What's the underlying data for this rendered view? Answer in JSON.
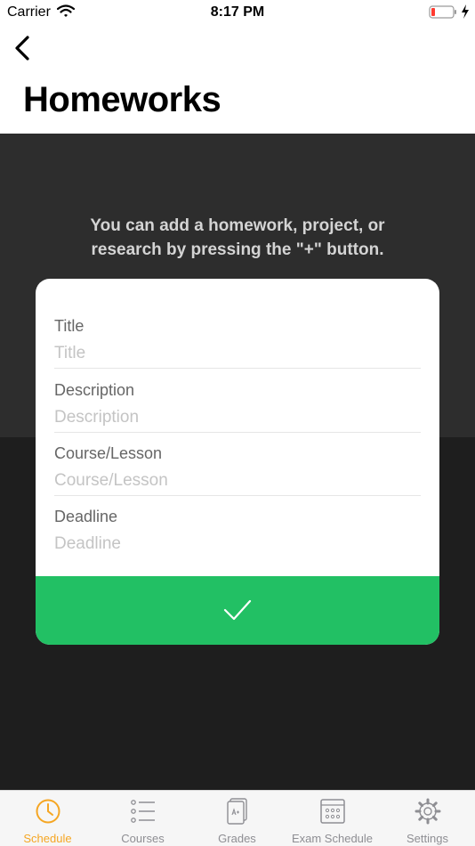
{
  "status_bar": {
    "carrier": "Carrier",
    "time": "8:17 PM"
  },
  "header": {
    "title": "Homeworks"
  },
  "hint": {
    "text": "You can add a homework, project, or research by pressing the \"+\" button."
  },
  "form": {
    "fields": [
      {
        "label": "Title",
        "placeholder": "Title",
        "value": ""
      },
      {
        "label": "Description",
        "placeholder": "Description",
        "value": ""
      },
      {
        "label": "Course/Lesson",
        "placeholder": "Course/Lesson",
        "value": ""
      },
      {
        "label": "Deadline",
        "placeholder": "Deadline",
        "value": ""
      }
    ],
    "submit_icon": "checkmark-icon",
    "submit_color": "#22c064"
  },
  "tabbar": {
    "active_color": "#f5a623",
    "tabs": [
      {
        "label": "Schedule",
        "icon": "clock-icon",
        "active": true
      },
      {
        "label": "Courses",
        "icon": "list-icon",
        "active": false
      },
      {
        "label": "Grades",
        "icon": "grades-document-icon",
        "active": false
      },
      {
        "label": "Exam Schedule",
        "icon": "calendar-icon",
        "active": false
      },
      {
        "label": "Settings",
        "icon": "gear-icon",
        "active": false
      }
    ]
  }
}
